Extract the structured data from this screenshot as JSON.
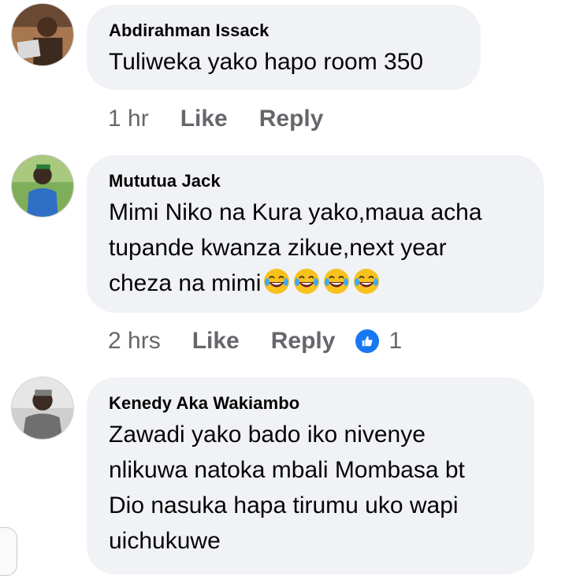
{
  "comments": [
    {
      "author": "Abdirahman Issack",
      "text": "Tuliweka yako hapo room 350",
      "time": "1 hr",
      "like_label": "Like",
      "reply_label": "Reply",
      "avatar_icon": "user-avatar"
    },
    {
      "author": "Mututua Jack",
      "text_lines": [
        "Mimi Niko na Kura yako,maua acha",
        "tupande kwanza zikue,next year",
        "cheza na mimi"
      ],
      "emoji_icons": [
        "laughing-tears-emoji",
        "laughing-tears-emoji",
        "laughing-tears-emoji",
        "laughing-tears-emoji"
      ],
      "time": "2 hrs",
      "like_label": "Like",
      "reply_label": "Reply",
      "reaction_icon": "thumbs-up-reaction",
      "reaction_count": "1",
      "avatar_icon": "user-avatar"
    },
    {
      "author": "Kenedy Aka Wakiambo",
      "text_lines": [
        "Zawadi yako bado iko nivenye",
        "nlikuwa natoka mbali Mombasa bt",
        "Dio nasuka hapa tirumu uko wapi",
        "uichukuwe"
      ],
      "avatar_icon": "user-avatar"
    }
  ],
  "colors": {
    "bubble": "#f0f2f5",
    "text": "#050505",
    "meta": "#65676b",
    "like_blue": "#1877f2"
  }
}
